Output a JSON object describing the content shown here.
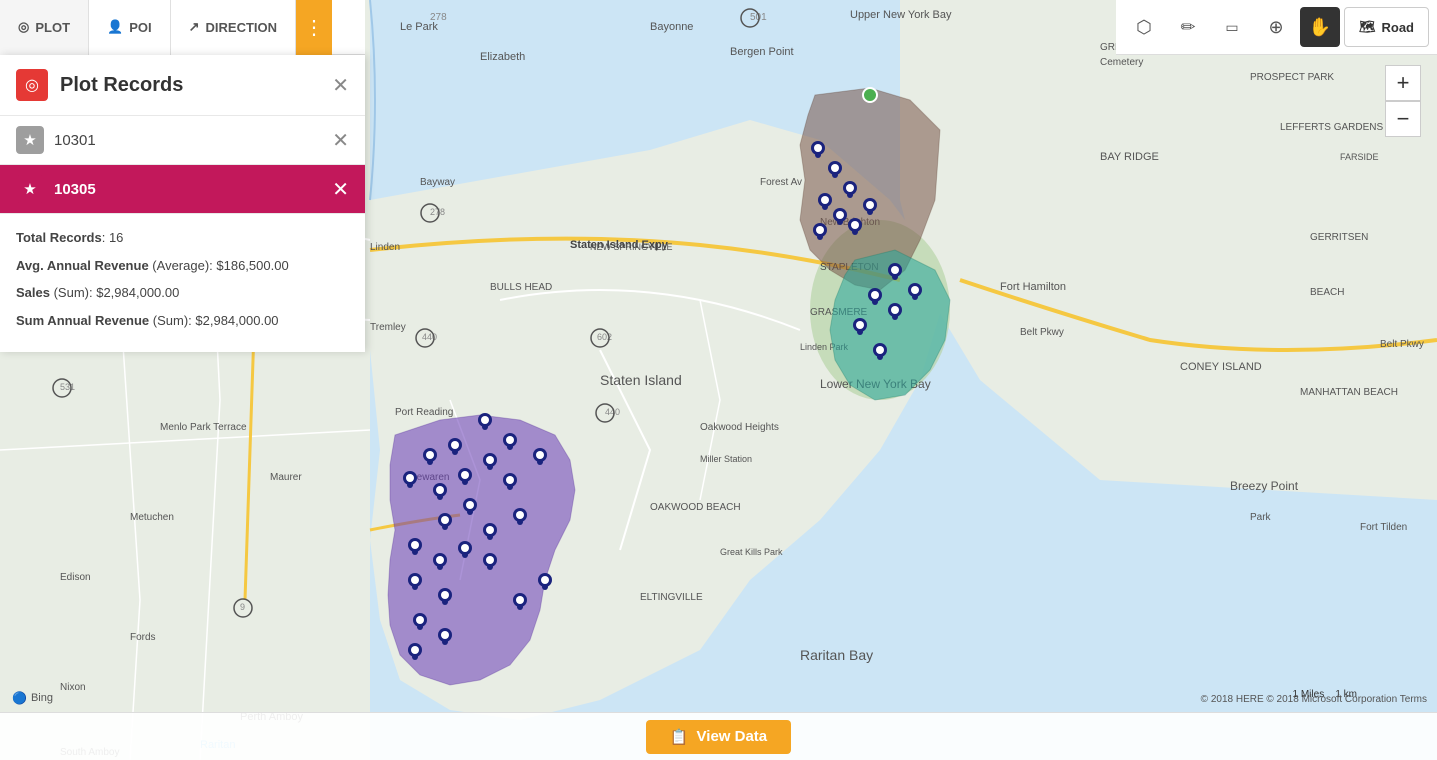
{
  "toolbar": {
    "buttons": [
      {
        "id": "plot",
        "label": "PLOT",
        "icon": "◎"
      },
      {
        "id": "poi",
        "label": "POI",
        "icon": "👤"
      },
      {
        "id": "direction",
        "label": "DIRECTION",
        "icon": "↗"
      },
      {
        "id": "more",
        "label": "⋮"
      }
    ]
  },
  "right_toolbar": {
    "buttons": [
      {
        "id": "select",
        "icon": "⬡",
        "label": "select-tool"
      },
      {
        "id": "pencil",
        "icon": "✏",
        "label": "draw-tool"
      },
      {
        "id": "erase",
        "icon": "⬜",
        "label": "erase-tool"
      },
      {
        "id": "edit",
        "icon": "⊕",
        "label": "edit-tool"
      },
      {
        "id": "hand",
        "icon": "✋",
        "label": "hand-tool"
      }
    ],
    "road_label": "Road"
  },
  "panel": {
    "title": "Plot Records",
    "icon": "◎",
    "tabs": [
      {
        "id": "tab1",
        "label": "10301",
        "active": false
      },
      {
        "id": "tab2",
        "label": "10305",
        "active": true
      }
    ],
    "stats": [
      {
        "label": "Total Records",
        "suffix": ": ",
        "value": "16"
      },
      {
        "label": "Avg. Annual Revenue",
        "suffix": " (Average): ",
        "value": "$186,500.00"
      },
      {
        "label": "Sales",
        "suffix": " (Sum): ",
        "value": "$2,984,000.00"
      },
      {
        "label": "Sum Annual Revenue",
        "suffix": " (Sum): ",
        "value": "$2,984,000.00"
      }
    ]
  },
  "bottom": {
    "view_data_label": "View Data"
  },
  "map": {
    "zoom_in": "+",
    "zoom_out": "−"
  },
  "attribution": {
    "bing": "Bing",
    "copyright": "© 2018 HERE © 2018 Microsoft Corporation  Terms"
  },
  "scale": {
    "miles": "1 Miles",
    "km": "1 km"
  }
}
